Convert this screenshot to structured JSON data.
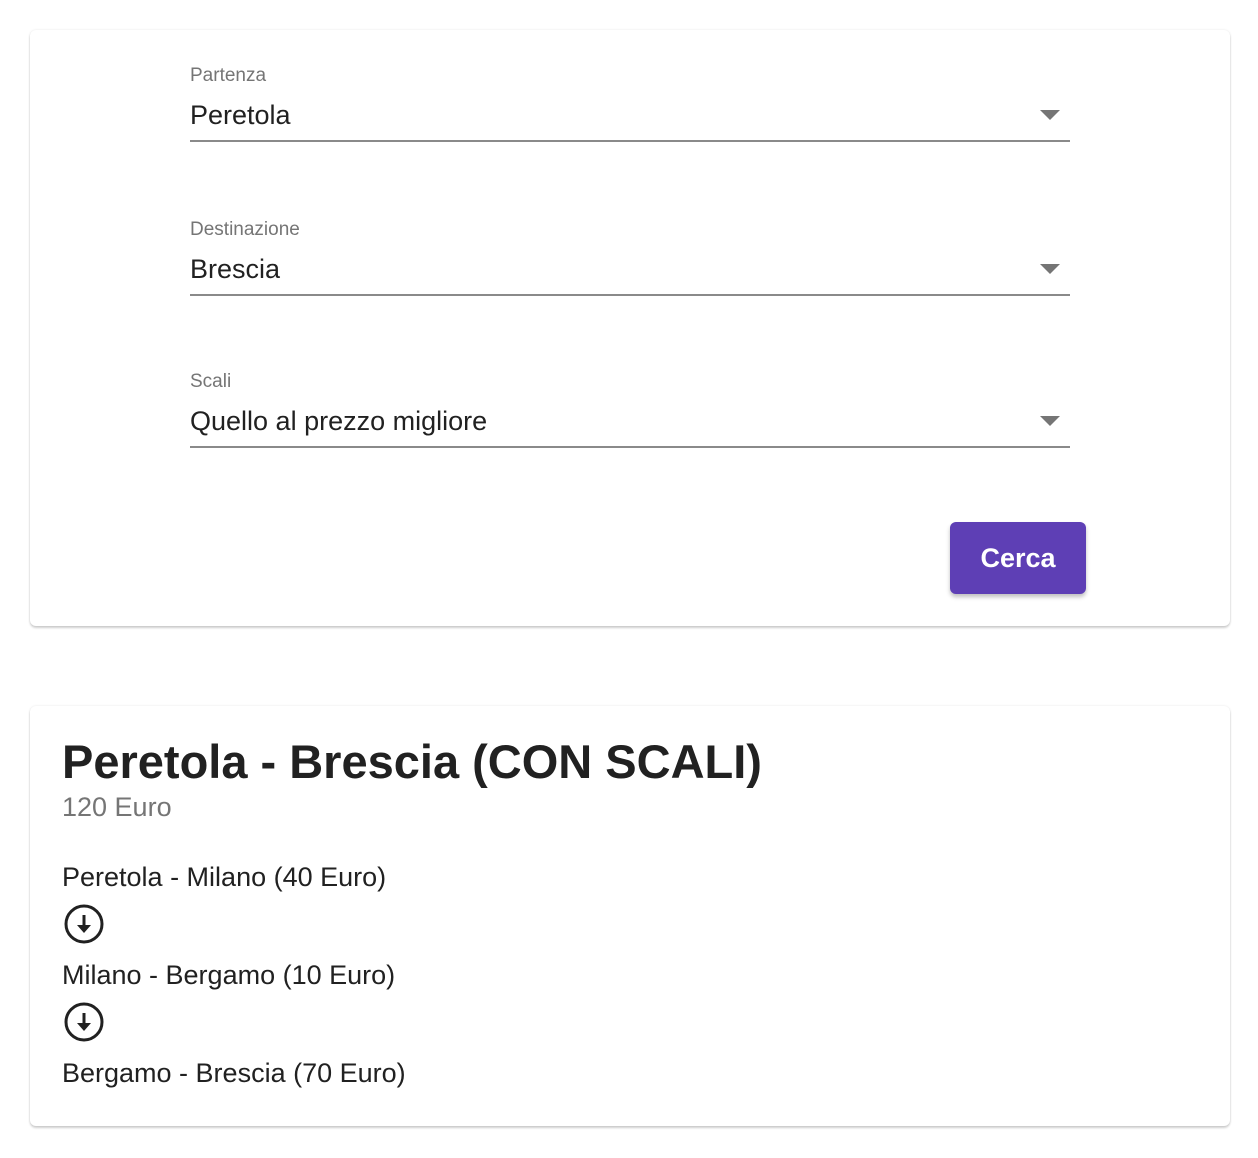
{
  "search": {
    "partenza": {
      "label": "Partenza",
      "value": "Peretola"
    },
    "destinazione": {
      "label": "Destinazione",
      "value": "Brescia"
    },
    "scali": {
      "label": "Scali",
      "value": "Quello al prezzo migliore"
    },
    "button_label": "Cerca"
  },
  "result": {
    "title": "Peretola - Brescia (CON SCALI)",
    "price": "120 Euro",
    "legs": [
      {
        "text": "Peretola - Milano (40 Euro)"
      },
      {
        "text": "Milano - Bergamo (10 Euro)"
      },
      {
        "text": "Bergamo - Brescia (70 Euro)"
      }
    ]
  },
  "icons": {
    "dropdown": "arrow-drop-down-icon",
    "leg_separator": "arrow-circle-down-icon"
  },
  "colors": {
    "accent": "#5e3fb5",
    "label": "#757575",
    "text": "#212121"
  }
}
